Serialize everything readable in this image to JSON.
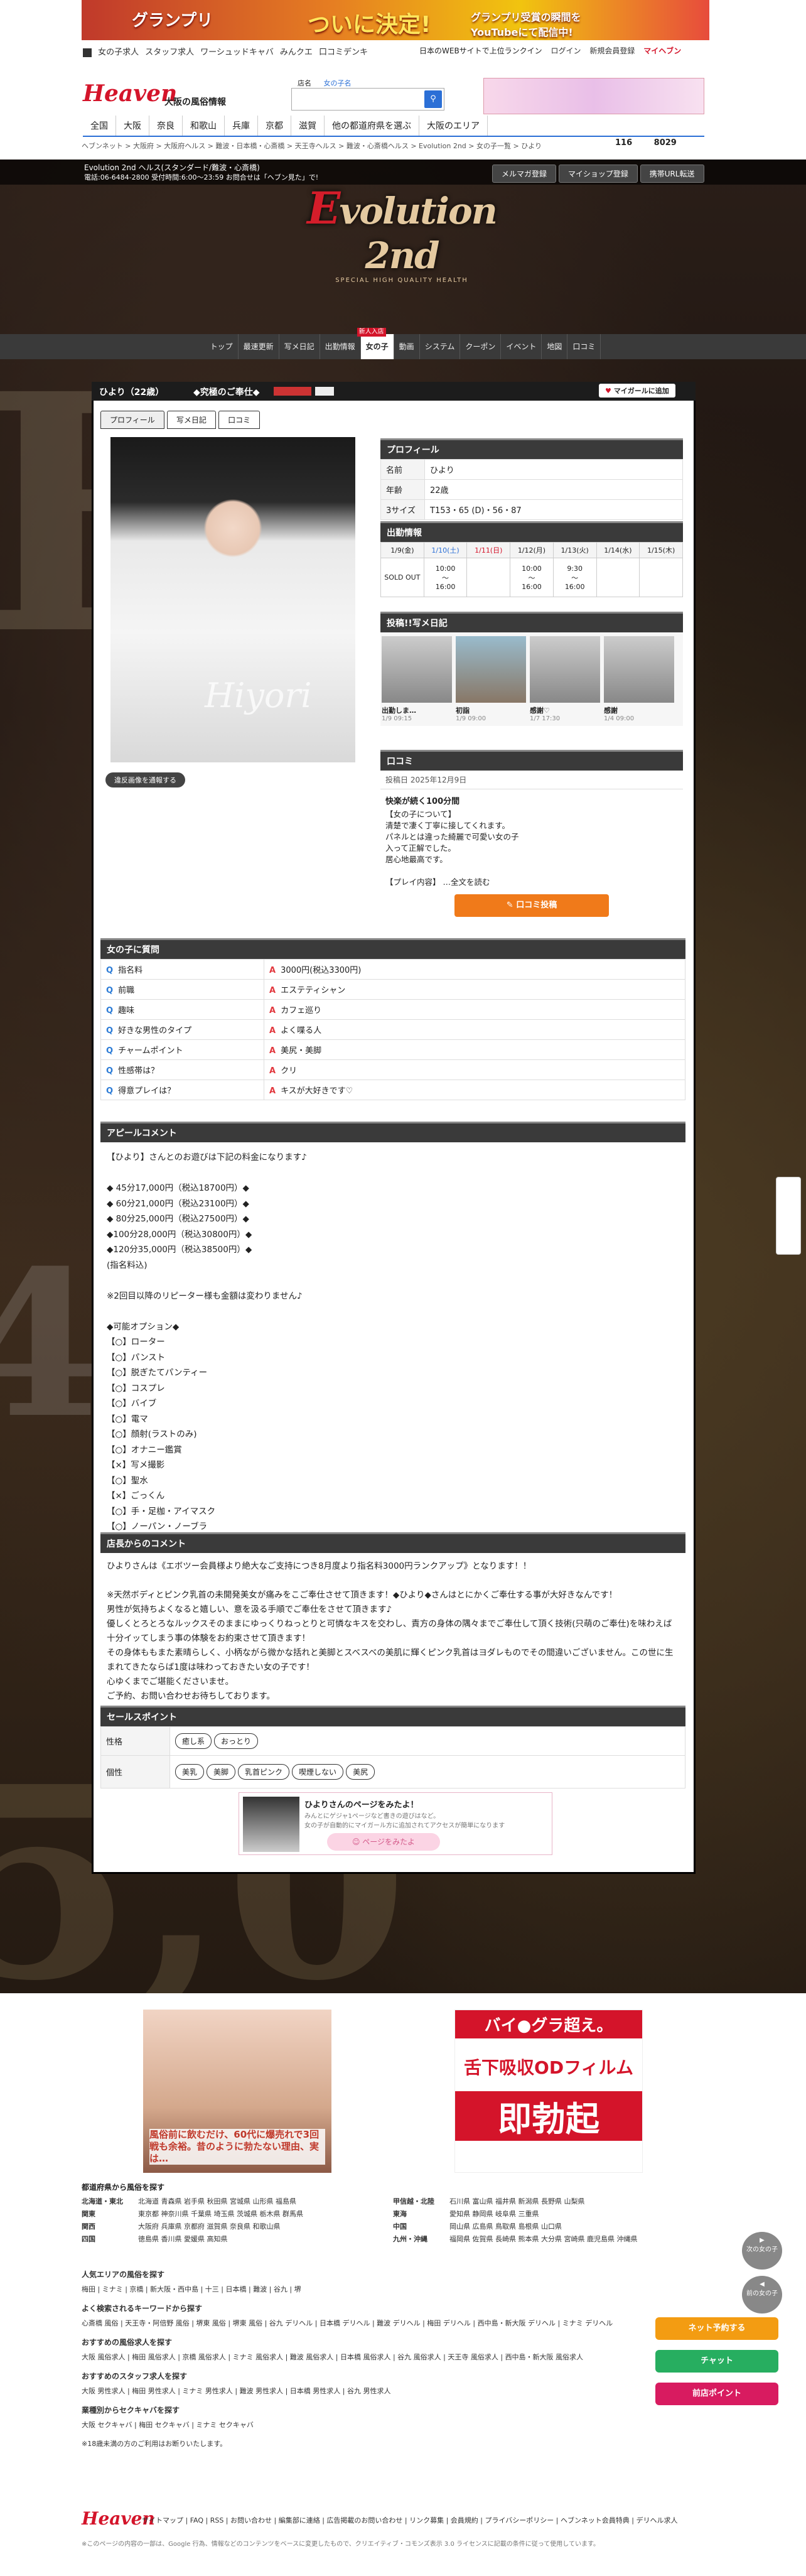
{
  "top_banner": {
    "text_left": "グランプリ",
    "text_mid": "ついに決定!",
    "text_right": "グランプリ受賞の瞬間をYouTubeにて配信中!"
  },
  "header": {
    "links": [
      "女の子求人",
      "スタッフ求人",
      "ワーシュッドキャバ",
      "みんクエ",
      "口コミデンキ"
    ],
    "tagline": "日本のWEBサイトで上位ランクイン",
    "login": "ログイン",
    "register": "新規会員登録",
    "mypage": "マイヘブン",
    "logo": "Heaven",
    "region": "大阪の風俗情報",
    "search_label": "店名",
    "search_link": "女の子名",
    "categories": [
      "全国",
      "大阪",
      "奈良",
      "和歌山",
      "兵庫",
      "京都",
      "滋賀",
      "他の都道府県を選ぶ",
      "大阪のエリア"
    ],
    "breadcrumb": "ヘブンネット > 大阪府 > 大阪府ヘルス > 難波・日本橋・心斎橋 > 天王寺ヘルス > 難波・心斎橋ヘルス > Evolution 2nd > 女の子一覧 > ひより",
    "count1": "116",
    "count2": "8029"
  },
  "shop": {
    "name": "Evolution 2nd ヘルス(スタンダード/難波・心斎橋)",
    "tel": "電話:06-6484-2800 受付時間:6:00〜23:59 お問合せは「ヘブン見た」で!",
    "buttons": [
      "メルマガ登録",
      "マイショップ登録",
      "携帯URL転送"
    ],
    "logo_main": "volution 2nd",
    "logo_e": "E",
    "logo_tag": "SPECIAL HIGH QUALITY HEALTH"
  },
  "gnav": [
    "トップ",
    "最速更新",
    "写メ日記",
    "出勤情報",
    "女の子",
    "動画",
    "システム",
    "クーポン",
    "イベント",
    "地図",
    "口コミ"
  ],
  "gnav_badge": "新人入店",
  "card": {
    "title": "ひより（22歳）",
    "notice": "◆究極のご奉仕◆",
    "mygirl": "マイガールに追加",
    "tabs": [
      "プロフィール",
      "写メ日記",
      "口コミ"
    ],
    "report_btn": "違反画像を通報する",
    "photo_sig": "Hiyori",
    "profile_h": "プロフィール",
    "profile": [
      [
        "名前",
        "ひより"
      ],
      [
        "年齢",
        "22歳"
      ],
      [
        "3サイズ",
        "T153・65 (D)・56・87"
      ]
    ],
    "schedule_h": "出勤情報",
    "days": [
      "1/9(金)",
      "1/10(土)",
      "1/11(日)",
      "1/12(月)",
      "1/13(火)",
      "1/14(水)",
      "1/15(木)"
    ],
    "times": [
      "SOLD OUT",
      "10:00\n〜\n16:00",
      "",
      "10:00\n〜\n16:00",
      "9:30\n〜\n16:00",
      "",
      ""
    ],
    "diary_h": "投稿!!写メ日記",
    "diary": [
      [
        "出勤しま…",
        "1/9 09:15"
      ],
      [
        "初詣",
        "1/9 09:00"
      ],
      [
        "感謝♡",
        "1/7 17:30"
      ],
      [
        "感謝",
        "1/4 09:00"
      ]
    ],
    "review_h": "口コミ",
    "review_date": "投稿日 2025年12月9日",
    "review_title": "快楽が続く100分間",
    "review_body": "【女の子について】\n清楚で凄く丁寧に接してくれます。\nパネルとは違った綺麗で可愛い女の子\n入って正解でした。\n居心地最高です。\n\n【プレイ内容】 …全文を読む",
    "review_btn": "口コミ投稿",
    "qa_h": "女の子に質問",
    "qa": [
      [
        "指名料",
        "3000円(税込3300円)"
      ],
      [
        "前職",
        "エステティシャン"
      ],
      [
        "趣味",
        "カフェ巡り"
      ],
      [
        "好きな男性のタイプ",
        "よく喋る人"
      ],
      [
        "チャームポイント",
        "美尻・美脚"
      ],
      [
        "性感帯は？",
        "クリ"
      ],
      [
        "得意プレイは？",
        "キスが大好きです♡"
      ]
    ],
    "appeal_h": "アピールコメント",
    "appeal": "【ひより】さんとのお遊びは下記の料金になります♪\n\n◆ 45分17,000円（税込18700円）◆\n◆ 60分21,000円（税込23100円）◆\n◆ 80分25,000円（税込27500円）◆\n◆100分28,000円（税込30800円）◆\n◆120分35,000円（税込38500円）◆\n(指名料込)\n\n※2回目以降のリピーター様も金額は変わりません♪\n\n◆可能オプション◆\n【○】ローター\n【○】パンスト\n【○】脱ぎたてパンティー\n【○】コスプレ\n【○】バイブ\n【○】電マ\n【○】顔射(ラストのみ)\n【○】オナニー鑑賞\n【×】写メ撮影\n【○】聖水\n【×】ごっくん\n【○】手・足枷・アイマスク\n【○】ノーパン・ノーブラ\n【×】即尺",
    "shop_comment_h": "店長からのコメント",
    "shop_comment": "ひよりさんは《エボツー会員様より絶大なご支持につき8月度より指名料3000円ランクアップ》となります！！\n\n※天然ボディとピンク乳首の未開発美女が痛みをこご奉仕させて頂きます！◆ひより◆さんはとにかくご奉仕する事が大好きなんです！\n男性が気持ちよくなると嬉しい、意を汲る手順でご奉仕をさせて頂きます♪\n優しくとろとろなルックスそのままにゆっくりねっとりと可憐なキスを交わし、責方の身体の隅々までご奉仕して頂く技術(只萌のご奉仕)を味わえば十分イッてしまう事の体験をお約束させて頂きます！\nその身体ももまた素晴らしく、小柄ながら微かな括れと美脚とスベスベの美肌に輝くピンク乳首はヨダレものでその間違いございません。この世に生まれてきたならば1度は味わっておきたい女の子です！\n心ゆくまでご堪能くださいませ。\nご予約、お問い合わせお待ちしております。",
    "sales_h": "セールスポイント",
    "sales": [
      [
        "性格",
        [
          "癒し系",
          "おっとり"
        ]
      ],
      [
        "個性",
        [
          "美乳",
          "美脚",
          "乳首ピンク",
          "喫煙しない",
          "美尻"
        ]
      ]
    ],
    "promo_title": "ひよりさんのページをみたよ！",
    "promo_text": "みんとにゲジャ1ページなど書きの遊びはなど。\n女の子が自動的にマイガール方に追加されてアクセスが簡単になります",
    "promo_btn": "ページをみたよ"
  },
  "footer": {
    "ad_left": "風俗前に飲むだけ、60代に爆売れで3回戦も余裕。昔のように勃たない理由、実は…",
    "ad_right_top": "バイ●グラ超え。",
    "ad_right_mid": "舌下吸収ODフィルム",
    "ad_right_bottom": "即勃起",
    "search_h": "都道府県から風俗を探す",
    "regions": [
      [
        "北海道・東北",
        "北海道 青森県 岩手県 秋田県 宮城県 山形県 福島県"
      ],
      [
        "関東",
        "東京都 神奈川県 千葉県 埼玉県 茨城県 栃木県 群馬県"
      ],
      [
        "関西",
        "大阪府 兵庫県 京都府 滋賀県 奈良県 和歌山県"
      ],
      [
        "四国",
        "徳島県 香川県 愛媛県 高知県"
      ]
    ],
    "regions2": [
      [
        "甲信越・北陸",
        "石川県 富山県 福井県 新潟県 長野県 山梨県"
      ],
      [
        "東海",
        "愛知県 静岡県 岐阜県 三重県"
      ],
      [
        "中国",
        "岡山県 広島県 鳥取県 島根県 山口県"
      ],
      [
        "九州・沖縄",
        "福岡県 佐賀県 長崎県 熊本県 大分県 宮崎県 鹿児島県 沖縄県"
      ]
    ],
    "pop_h": "人気エリアの風俗を探す",
    "pop": "梅田 | ミナミ | 京橋 | 新大阪・西中島 | 十三 | 日本橋 | 難波 | 谷九 | 堺",
    "kw_h": "よく検索されるキーワードから探す",
    "kw": "心斎橋 風俗 | 天王寺・阿倍野 風俗 | 堺東 風俗 | 堺東 風俗 | 谷九 デリヘル | 日本橋 デリヘル | 難波 デリヘル | 梅田 デリヘル | 西中島・新大阪 デリヘル | ミナミ デリヘル",
    "recruit_h": "おすすめの風俗求人を探す",
    "recruit": "大阪 風俗求人 | 梅田 風俗求人 | 京橋 風俗求人 | ミナミ 風俗求人 | 難波 風俗求人 | 日本橋 風俗求人 | 谷九 風俗求人 | 天王寺 風俗求人 | 西中島・新大阪 風俗求人",
    "staff_h": "おすすめのスタッフ求人を探す",
    "staff": "大阪 男性求人 | 梅田 男性求人 | ミナミ 男性求人 | 難波 男性求人 | 日本橋 男性求人 | 谷九 男性求人",
    "cabaret_h": "業種別からセクキャバを探す",
    "cabaret": "大阪 セクキャバ | 梅田 セクキャバ | ミナミ セクキャバ",
    "age_note": "※18歳未満の方のご利用はお断りいたします。",
    "links": "サイトマップ | FAQ | RSS | お問い合わせ | 編集部に連絡 | 広告掲載のお問い合わせ | リンク募集 | 会員規約 | プライバシーポリシー | ヘブンネット会員特典 | デリヘル求人",
    "copyright": "※このページの内容の一部は、Google 行為、情報などのコンテンツをベースに変更したもので、クリエイティブ・コモンズ表示 3.0 ライセンスに記載の条件に従って使用しています。"
  },
  "side": {
    "next": "次の女の子",
    "prev": "前の女の子",
    "float_btns": [
      "ネット予約する",
      "チャット",
      "前店ポイント"
    ]
  }
}
